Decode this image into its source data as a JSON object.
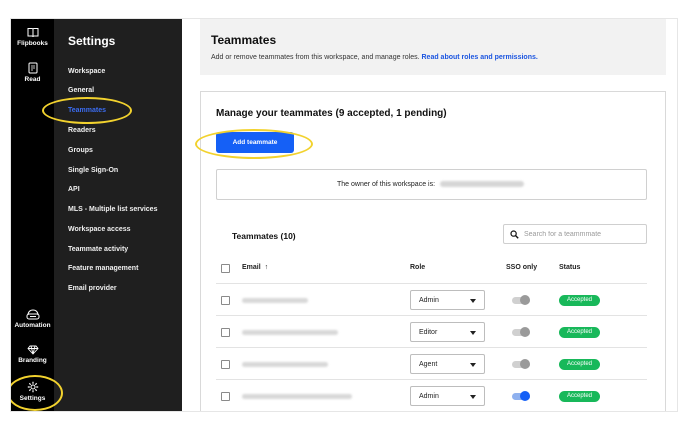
{
  "rail": {
    "items": [
      {
        "label": "Flipbooks",
        "icon": "book-icon"
      },
      {
        "label": "Read",
        "icon": "document-icon"
      },
      {
        "label": "Automation",
        "icon": "robot-icon"
      },
      {
        "label": "Branding",
        "icon": "diamond-icon"
      },
      {
        "label": "Settings",
        "icon": "gear-icon"
      }
    ]
  },
  "nav": {
    "title": "Settings",
    "items": [
      "Workspace",
      "General",
      "Teammates",
      "Readers",
      "Groups",
      "Single Sign-On",
      "API",
      "MLS - Multiple list services",
      "Workspace access",
      "Teammate activity",
      "Feature management",
      "Email provider"
    ],
    "active_index": 2
  },
  "header": {
    "title": "Teammates",
    "subtitle": "Add or remove teammates from this workspace, and manage roles.",
    "link": "Read about roles and permissions."
  },
  "card": {
    "title": "Manage your teammates (9 accepted, 1 pending)",
    "add_button": "Add teammate",
    "owner_label": "The owner of this workspace is:",
    "teammates_count": "Teammates (10)",
    "search_placeholder": "Search for a teammmate",
    "columns": {
      "email": "Email",
      "sort_arrow": "↑",
      "role": "Role",
      "sso": "SSO only",
      "status": "Status"
    },
    "rows": [
      {
        "role": "Admin",
        "sso_on": false,
        "status": "Accepted"
      },
      {
        "role": "Editor",
        "sso_on": false,
        "status": "Accepted"
      },
      {
        "role": "Agent",
        "sso_on": false,
        "status": "Accepted"
      },
      {
        "role": "Admin",
        "sso_on": true,
        "status": "Accepted"
      }
    ]
  },
  "colors": {
    "accent": "#1560f6",
    "status_green": "#18b85a",
    "highlight": "#f2d22e",
    "rail_bg": "#000000",
    "nav_bg": "#1f1f1f"
  }
}
